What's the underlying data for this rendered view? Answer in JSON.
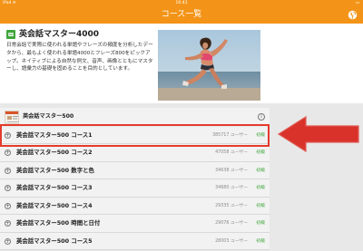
{
  "status_bar": {
    "left": "iPad ≋",
    "time": "16:43",
    "right": "▭"
  },
  "nav": {
    "title": "コース一覧",
    "action_icon": "globe-icon"
  },
  "hero": {
    "icon": "course-icon",
    "title": "英会話マスター4000",
    "description": "日常会話で実際に使われる単語やフレーズの頻度を分析したデータから、最もよく使われる単語4000とフレーズ800をピックアップ。ネイティブによる自然な例文、音声、画像とともにマスターし、語彙力の基礎を固めることを目的としています。"
  },
  "section": {
    "title": "英会話マスター500",
    "info_icon": "i"
  },
  "rows": [
    {
      "name": "英会話マスター500 コース1",
      "users": "385717 ユーザー",
      "level": "初級"
    },
    {
      "name": "英会話マスター500 コース2",
      "users": "47058 ユーザー",
      "level": "初級"
    },
    {
      "name": "英会話マスター500 数字と色",
      "users": "34638 ユーザー",
      "level": "初級"
    },
    {
      "name": "英会話マスター500 コース3",
      "users": "34680 ユーザー",
      "level": "初級"
    },
    {
      "name": "英会話マスター500 コース4",
      "users": "29335 ユーザー",
      "level": "初級"
    },
    {
      "name": "英会話マスター500 時間と日付",
      "users": "29076 ユーザー",
      "level": "初級"
    },
    {
      "name": "英会話マスター500 コース5",
      "users": "28003 ユーザー",
      "level": "初級"
    }
  ],
  "colors": {
    "accent": "#f39418",
    "level": "#3ea53a",
    "highlight": "#e53b2c",
    "list_bg": "#f2f2f2"
  }
}
